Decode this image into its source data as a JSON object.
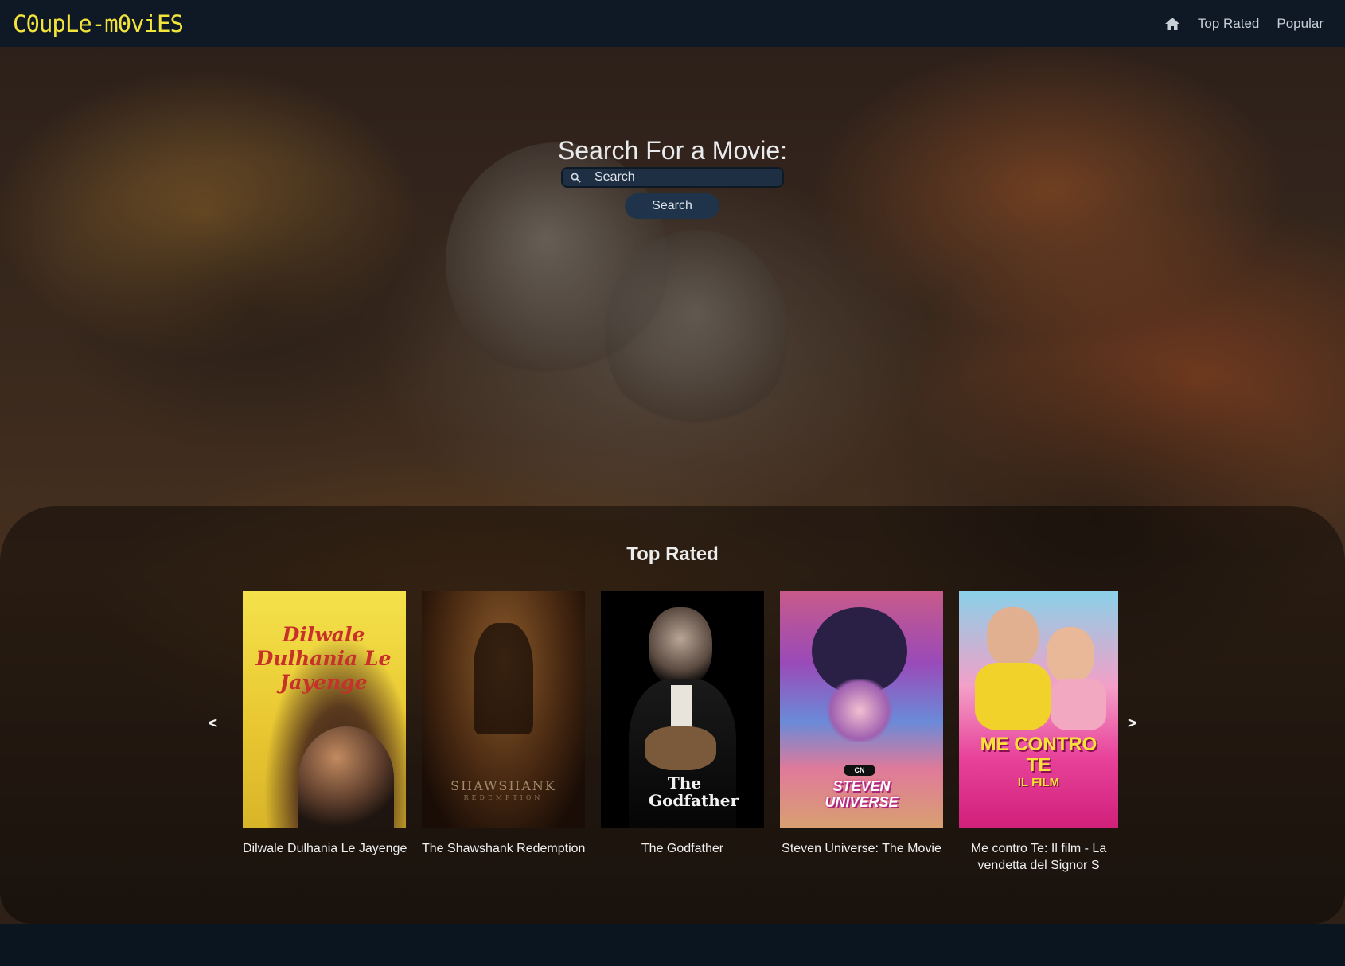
{
  "navbar": {
    "brand": "C0upLe-m0viES",
    "links": [
      {
        "icon": "home-icon"
      },
      {
        "label": "Top Rated"
      },
      {
        "label": "Popular"
      }
    ]
  },
  "search": {
    "title": "Search For a Movie:",
    "placeholder": "Search",
    "button_label": "Search"
  },
  "top_rated": {
    "title": "Top Rated",
    "prev_label": "<",
    "next_label": ">",
    "movies": [
      {
        "title": "Dilwale Dulhania Le Jayenge",
        "poster_text": "Dilwale Dulhania Le Jayenge"
      },
      {
        "title": "The Shawshank Redemption",
        "poster_text": "SHAWSHANK",
        "poster_subtext": "REDEMPTION"
      },
      {
        "title": "The Godfather",
        "poster_text": "The Godfather"
      },
      {
        "title": "Steven Universe: The Movie",
        "poster_text": "STEVEN UNIVERSE",
        "poster_subtext": "CN"
      },
      {
        "title": "Me contro Te: Il film - La vendetta del Signor S",
        "poster_text": "ME CONTRO TE",
        "poster_subtext": "IL FILM"
      }
    ]
  },
  "colors": {
    "brand": "#f2e43a",
    "navbar_bg": "#0e1925",
    "search_button_bg": "#1f344b"
  }
}
